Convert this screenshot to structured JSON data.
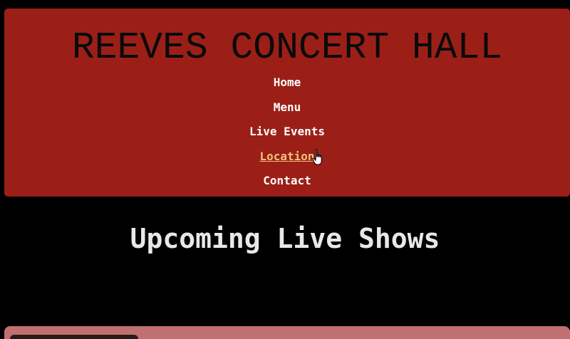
{
  "header": {
    "title": "REEVES CONCERT HALL",
    "nav": [
      {
        "label": "Home",
        "active": false
      },
      {
        "label": "Menu",
        "active": false
      },
      {
        "label": "Live Events",
        "active": false
      },
      {
        "label": "Location",
        "active": true
      },
      {
        "label": "Contact",
        "active": false
      }
    ]
  },
  "main": {
    "heading": "Upcoming Live Shows"
  },
  "colors": {
    "header_bg": "#9b1f17",
    "page_bg": "#000000",
    "nav_active": "#f2c27a",
    "card_bg": "#c07070"
  },
  "icons": {
    "cursor": "hand-pointer-icon"
  }
}
